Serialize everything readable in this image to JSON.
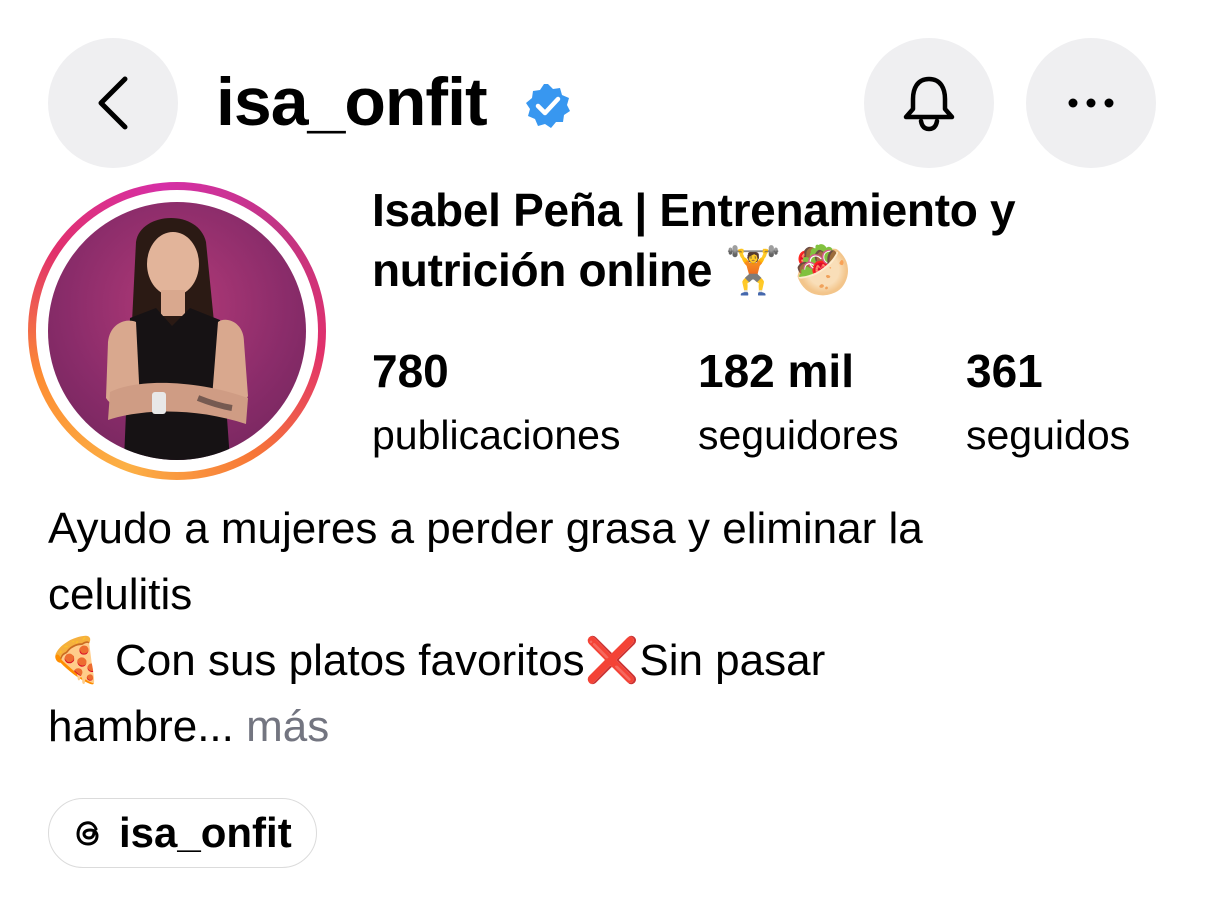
{
  "header": {
    "username": "isa_onfit",
    "verified": true
  },
  "profile": {
    "full_name_line1": "Isabel Peña | Entrenamiento y",
    "full_name_line2": "nutrición online 🏋️ 🥙",
    "stats": [
      {
        "value": "780",
        "label": "publicaciones"
      },
      {
        "value": "182 mil",
        "label": "seguidores"
      },
      {
        "value": "361",
        "label": "seguidos"
      }
    ]
  },
  "bio": {
    "line1": "Ayudo a mujeres a perder grasa y eliminar la",
    "line2": "celulitis",
    "line3": "🍕  Con sus platos favoritos❌Sin pasar",
    "line4": "hambre...",
    "more": "más"
  },
  "threads": {
    "label": "isa_onfit"
  },
  "icons": {
    "back": "chevron-left-icon",
    "bell": "bell-icon",
    "more": "ellipsis-icon",
    "verified": "verified-badge-icon",
    "threads": "threads-icon"
  },
  "colors": {
    "button_bg": "#efeff1",
    "verified_blue": "#3897f0",
    "more_gray": "#737580",
    "ring_start": "#fcb045",
    "ring_end": "#c13584"
  }
}
